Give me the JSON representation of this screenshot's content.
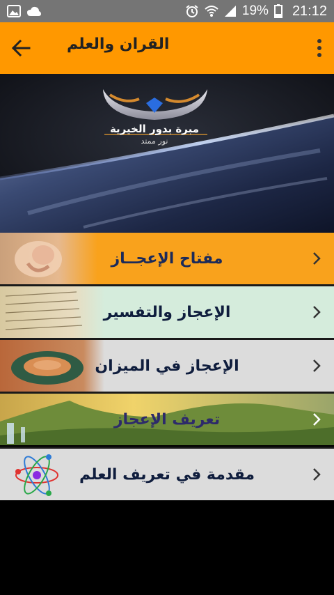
{
  "status_bar": {
    "battery_percent": "19%",
    "time": "21:12"
  },
  "app_bar": {
    "title": "القران والعلم"
  },
  "banner": {
    "logo_title": "نور",
    "logo_line1": "مبرة بدور الخيرية",
    "logo_line2": "نور ممتد"
  },
  "menu": [
    {
      "label": "مفتاح الإعجــاز"
    },
    {
      "label": "الإعجاز والتفسير"
    },
    {
      "label": "الإعجاز في الميزان"
    },
    {
      "label": "تعريف الإعجاز"
    },
    {
      "label": "مقدمة في تعريف العلم"
    }
  ],
  "colors": {
    "app_bar": "#ff9800",
    "status_bar": "#757575",
    "item_orange": "#f9a21c",
    "item_mint": "#d5ecdc",
    "item_gray": "#dcdcdc"
  }
}
